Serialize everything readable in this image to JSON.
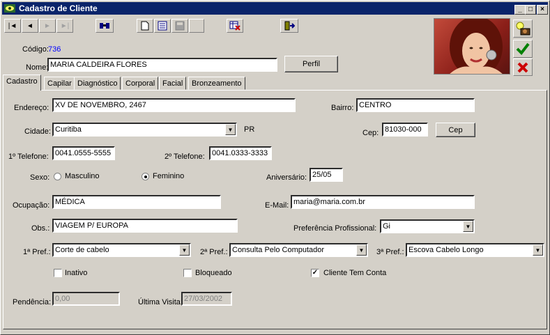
{
  "window": {
    "title": "Cadastro de Cliente",
    "minimize": "_",
    "maximize": "□",
    "close": "×"
  },
  "toolbar": {
    "first": "|◄",
    "prev": "◄",
    "next": "►",
    "last": "►|"
  },
  "header": {
    "codigo_label": "Código:",
    "codigo_value": "736",
    "nome_label": "Nome:",
    "nome_value": "MARIA CALDEIRA FLORES",
    "perfil_button": "Perfil"
  },
  "tabs": [
    "Cadastro",
    "Capilar",
    "Diagnóstico",
    "Corporal",
    "Facial",
    "Bronzeamento"
  ],
  "form": {
    "endereco_label": "Endereço:",
    "endereco_value": "XV DE NOVEMBRO, 2467",
    "bairro_label": "Bairro:",
    "bairro_value": "CENTRO",
    "cidade_label": "Cidade:",
    "cidade_value": "Curitiba",
    "uf_value": "PR",
    "cep_label": "Cep:",
    "cep_value": "81030-000",
    "cep_button": "Cep",
    "tel1_label": "1º Telefone:",
    "tel1_value": "0041.0555-5555",
    "tel2_label": "2º Telefone:",
    "tel2_value": "0041.0333-3333",
    "sexo_label": "Sexo:",
    "masculino_label": "Masculino",
    "feminino_label": "Feminino",
    "aniversario_label": "Aniversário:",
    "aniversario_value": "25/05",
    "ocupacao_label": "Ocupação:",
    "ocupacao_value": "MÉDICA",
    "email_label": "E-Mail:",
    "email_value": "maria@maria.com.br",
    "obs_label": "Obs.:",
    "obs_value": "VIAGEM P/ EUROPA",
    "pref_prof_label": "Preferência Profissional:",
    "pref_prof_value": "Gi",
    "pref1_label": "1ª Pref.:",
    "pref1_value": "Corte de cabelo",
    "pref2_label": "2ª Pref.:",
    "pref2_value": "Consulta Pelo Computador",
    "pref3_label": "3ª Pref.:",
    "pref3_value": "Escova Cabelo Longo",
    "inativo_label": "Inativo",
    "bloqueado_label": "Bloqueado",
    "conta_label": "Cliente Tem Conta",
    "pendencia_label": "Pendência:",
    "pendencia_value": "0,00",
    "ultima_visita_label": "Última Visita:",
    "ultima_visita_value": "27/03/2002"
  },
  "state": {
    "sexo": "Feminino",
    "inativo": false,
    "bloqueado": false,
    "cliente_tem_conta": true
  },
  "colors": {
    "title_bar": "#0a246a",
    "codigo_value": "#0000ff",
    "confirm": "#008000",
    "cancel": "#cc0000"
  }
}
